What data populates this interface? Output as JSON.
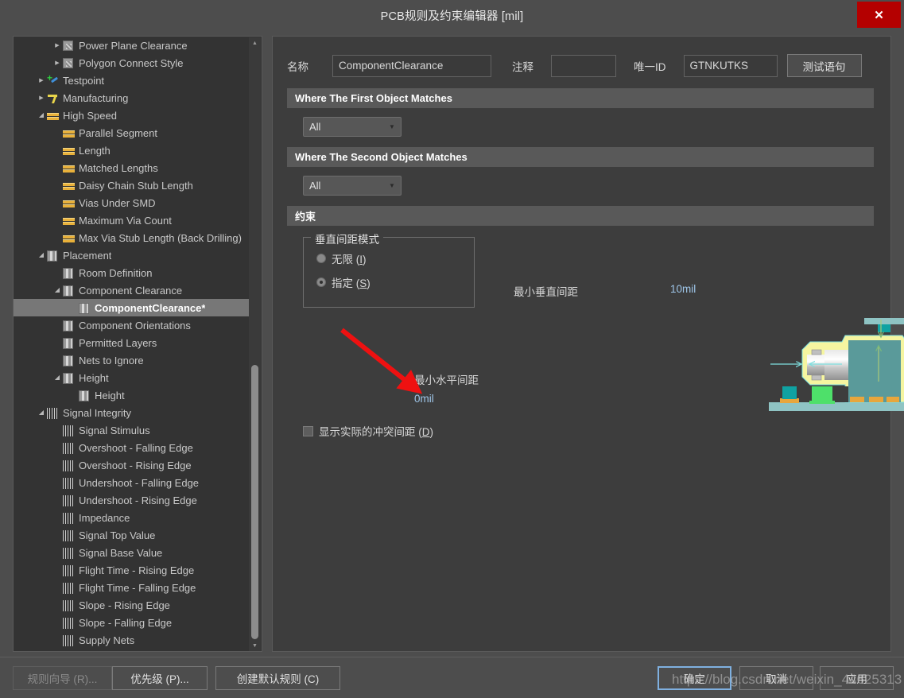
{
  "window": {
    "title": "PCB规则及约束编辑器 [mil]",
    "close_label": "✕"
  },
  "tree": {
    "items": [
      {
        "label": "Power Plane Clearance",
        "indent": 2,
        "arrow": "collapsed",
        "icon": "power-plane-clearance-icon",
        "selected": false
      },
      {
        "label": "Polygon Connect Style",
        "indent": 2,
        "arrow": "collapsed",
        "icon": "polygon-connect-style-icon",
        "selected": false
      },
      {
        "label": "Testpoint",
        "indent": 1,
        "arrow": "collapsed",
        "icon": "testpoint-icon",
        "selected": false
      },
      {
        "label": "Manufacturing",
        "indent": 1,
        "arrow": "collapsed",
        "icon": "manufacturing-icon",
        "selected": false
      },
      {
        "label": "High Speed",
        "indent": 1,
        "arrow": "expanded",
        "icon": "high-speed-icon",
        "selected": false
      },
      {
        "label": "Parallel Segment",
        "indent": 2,
        "arrow": "none",
        "icon": "high-speed-icon",
        "selected": false
      },
      {
        "label": "Length",
        "indent": 2,
        "arrow": "none",
        "icon": "high-speed-icon",
        "selected": false
      },
      {
        "label": "Matched Lengths",
        "indent": 2,
        "arrow": "none",
        "icon": "high-speed-icon",
        "selected": false
      },
      {
        "label": "Daisy Chain Stub Length",
        "indent": 2,
        "arrow": "none",
        "icon": "high-speed-icon",
        "selected": false
      },
      {
        "label": "Vias Under SMD",
        "indent": 2,
        "arrow": "none",
        "icon": "high-speed-icon",
        "selected": false
      },
      {
        "label": "Maximum Via Count",
        "indent": 2,
        "arrow": "none",
        "icon": "high-speed-icon",
        "selected": false
      },
      {
        "label": "Max Via Stub Length (Back Drilling)",
        "indent": 2,
        "arrow": "none",
        "icon": "high-speed-icon",
        "selected": false
      },
      {
        "label": "Placement",
        "indent": 1,
        "arrow": "expanded",
        "icon": "placement-icon",
        "selected": false
      },
      {
        "label": "Room Definition",
        "indent": 2,
        "arrow": "none",
        "icon": "placement-icon",
        "selected": false
      },
      {
        "label": "Component Clearance",
        "indent": 2,
        "arrow": "expanded",
        "icon": "placement-icon",
        "selected": false
      },
      {
        "label": "ComponentClearance*",
        "indent": 3,
        "arrow": "none",
        "icon": "placement-icon",
        "selected": true
      },
      {
        "label": "Component Orientations",
        "indent": 2,
        "arrow": "none",
        "icon": "placement-icon",
        "selected": false
      },
      {
        "label": "Permitted Layers",
        "indent": 2,
        "arrow": "none",
        "icon": "placement-icon",
        "selected": false
      },
      {
        "label": "Nets to Ignore",
        "indent": 2,
        "arrow": "none",
        "icon": "placement-icon",
        "selected": false
      },
      {
        "label": "Height",
        "indent": 2,
        "arrow": "expanded",
        "icon": "placement-icon",
        "selected": false
      },
      {
        "label": "Height",
        "indent": 3,
        "arrow": "none",
        "icon": "placement-icon",
        "selected": false
      },
      {
        "label": "Signal Integrity",
        "indent": 1,
        "arrow": "expanded",
        "icon": "signal-integrity-icon",
        "selected": false
      },
      {
        "label": "Signal Stimulus",
        "indent": 2,
        "arrow": "none",
        "icon": "signal-integrity-icon",
        "selected": false
      },
      {
        "label": "Overshoot - Falling Edge",
        "indent": 2,
        "arrow": "none",
        "icon": "signal-integrity-icon",
        "selected": false
      },
      {
        "label": "Overshoot - Rising Edge",
        "indent": 2,
        "arrow": "none",
        "icon": "signal-integrity-icon",
        "selected": false
      },
      {
        "label": "Undershoot - Falling Edge",
        "indent": 2,
        "arrow": "none",
        "icon": "signal-integrity-icon",
        "selected": false
      },
      {
        "label": "Undershoot - Rising Edge",
        "indent": 2,
        "arrow": "none",
        "icon": "signal-integrity-icon",
        "selected": false
      },
      {
        "label": "Impedance",
        "indent": 2,
        "arrow": "none",
        "icon": "signal-integrity-icon",
        "selected": false
      },
      {
        "label": "Signal Top Value",
        "indent": 2,
        "arrow": "none",
        "icon": "signal-integrity-icon",
        "selected": false
      },
      {
        "label": "Signal Base Value",
        "indent": 2,
        "arrow": "none",
        "icon": "signal-integrity-icon",
        "selected": false
      },
      {
        "label": "Flight Time - Rising Edge",
        "indent": 2,
        "arrow": "none",
        "icon": "signal-integrity-icon",
        "selected": false
      },
      {
        "label": "Flight Time - Falling Edge",
        "indent": 2,
        "arrow": "none",
        "icon": "signal-integrity-icon",
        "selected": false
      },
      {
        "label": "Slope - Rising Edge",
        "indent": 2,
        "arrow": "none",
        "icon": "signal-integrity-icon",
        "selected": false
      },
      {
        "label": "Slope - Falling Edge",
        "indent": 2,
        "arrow": "none",
        "icon": "signal-integrity-icon",
        "selected": false
      },
      {
        "label": "Supply Nets",
        "indent": 2,
        "arrow": "none",
        "icon": "signal-integrity-icon",
        "selected": false
      }
    ]
  },
  "form": {
    "name_label": "名称",
    "name_value": "ComponentClearance",
    "comment_label": "注释",
    "comment_value": "",
    "unique_id_label": "唯一ID",
    "unique_id_value": "GTNKUTKS",
    "test_button": "测试语句"
  },
  "sections": {
    "first_object": {
      "header": "Where The First Object Matches",
      "scope_value": "All"
    },
    "second_object": {
      "header": "Where The Second Object Matches",
      "scope_value": "All"
    },
    "constraints": {
      "header": "约束"
    }
  },
  "constraints": {
    "vertical_mode_group": "垂直间距模式",
    "radio_infinite": "无限 (I)",
    "radio_infinite_accel": "I",
    "radio_specified": "指定 (S)",
    "radio_specified_accel": "S",
    "selected_mode": "specified",
    "show_actual_label": "显示实际的冲突间距 (D)",
    "show_actual_accel": "D",
    "show_actual_checked": false,
    "min_horizontal_label": "最小水平间距",
    "min_horizontal_value": "0mil",
    "min_vertical_label": "最小垂直间距",
    "min_vertical_value": "10mil"
  },
  "footer": {
    "rule_wizard": "规则向导 (R)...",
    "rule_wizard_disabled": true,
    "priority": "优先级 (P)...",
    "create_default": "创建默认规则 (C)",
    "ok": "确定",
    "cancel": "取消",
    "apply": "应用"
  },
  "watermark": {
    "text": "https://blog.csdn.net/weixin_44625313"
  },
  "colors": {
    "accent_red": "#b40000",
    "band": "#595959",
    "selection": "#777777",
    "value_blue": "#9ec5e8",
    "illus_body": "#5a9a9a",
    "illus_outline": "#f5f5a0",
    "illus_green": "#4ee06a",
    "illus_orange": "#e8a63c",
    "arrow_red": "#ee1111"
  }
}
